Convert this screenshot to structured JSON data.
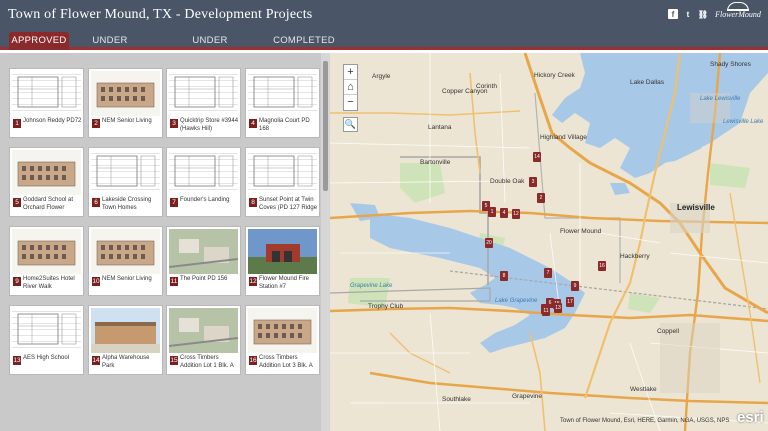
{
  "header": {
    "title": "Town of Flower Mound, TX - Development Projects",
    "logo_text": "FlowerMound"
  },
  "social": {
    "facebook": "f",
    "twitter": "t",
    "link": "⛓"
  },
  "tabs": [
    "APPROVED",
    "UNDER REVIEW",
    "UNDER CONSTRUCTION",
    "COMPLETED"
  ],
  "active_tab": 0,
  "projects": [
    {
      "num": "1",
      "label": "Johnson Reddy PD72"
    },
    {
      "num": "2",
      "label": "NEM Senior Living"
    },
    {
      "num": "3",
      "label": "Quicktrip Store #3944 (Hawks Hill)"
    },
    {
      "num": "4",
      "label": "Magnolia Court PD 168"
    },
    {
      "num": "5",
      "label": "Goddard School at Orchard Flower"
    },
    {
      "num": "6",
      "label": "Lakeside Crossing Town Homes"
    },
    {
      "num": "7",
      "label": "Founder's Landing"
    },
    {
      "num": "8",
      "label": "Sunset Point at Twin Coves (PD 127 Ridge"
    },
    {
      "num": "9",
      "label": "Home2Suites Hotel River Walk"
    },
    {
      "num": "10",
      "label": "NEM Senior Living"
    },
    {
      "num": "11",
      "label": "The Point PD 156"
    },
    {
      "num": "12",
      "label": "Flower Mound Fire Station #7"
    },
    {
      "num": "13",
      "label": "AES High School"
    },
    {
      "num": "14",
      "label": "Alpha Warehouse Park"
    },
    {
      "num": "15",
      "label": "Cross Timbers Addition Lot 1 Blk. A"
    },
    {
      "num": "16",
      "label": "Cross Timbers Addition Lot 3 Blk. A"
    }
  ],
  "map": {
    "zoom_in": "+",
    "home": "⌂",
    "zoom_out": "−",
    "search": "🔍",
    "labels": [
      {
        "text": "Argyle"
      },
      {
        "text": "Hickory Creek"
      },
      {
        "text": "Lake Dallas"
      },
      {
        "text": "Copper Canyon"
      },
      {
        "text": "Corinth"
      },
      {
        "text": "Lantana"
      },
      {
        "text": "Highland Village"
      },
      {
        "text": "Bartonville"
      },
      {
        "text": "Double Oak"
      },
      {
        "text": "Lewisville"
      },
      {
        "text": "Flower Mound"
      },
      {
        "text": "Trophy Club"
      },
      {
        "text": "Grapevine"
      },
      {
        "text": "Southlake"
      },
      {
        "text": "Coppell"
      },
      {
        "text": "Hackberry"
      },
      {
        "text": "Lake Lewisville"
      },
      {
        "text": "Grapevine Lake"
      },
      {
        "text": "Shady Shores"
      },
      {
        "text": "Lewisville Lake"
      },
      {
        "text": "Lake Grapevine"
      },
      {
        "text": "Westlake"
      }
    ],
    "markers": [
      "14",
      "3",
      "2",
      "5",
      "1",
      "4",
      "12",
      "20",
      "8",
      "7",
      "16",
      "9",
      "6",
      "10",
      "15",
      "13",
      "11",
      "17"
    ],
    "attribution": "Town of Flower Mound, Esri, HERE, Garmin, NGA, USGS, NPS",
    "esri": "esri"
  },
  "colors": {
    "header": "#4a5568",
    "accent": "#8b2a2a",
    "marker": "#8b2a2a"
  }
}
